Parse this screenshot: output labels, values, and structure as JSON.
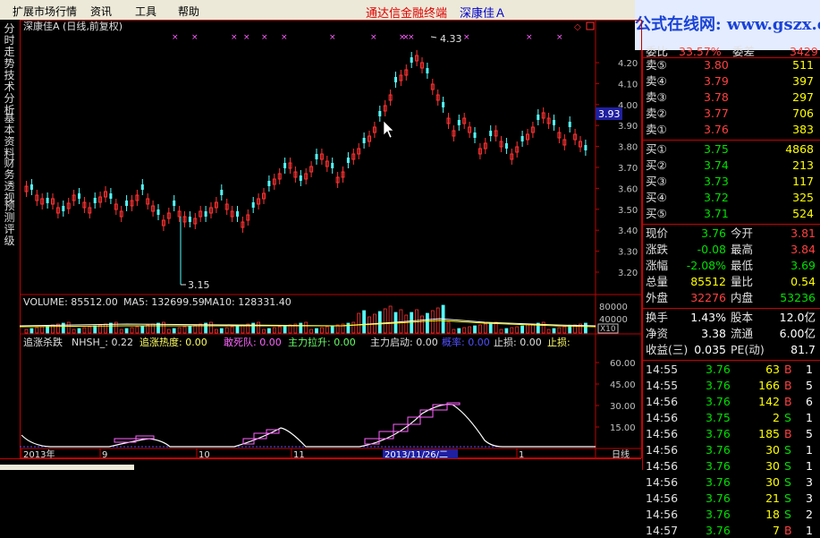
{
  "menu": {
    "items": [
      "扩展市场行情",
      "资讯",
      "工具",
      "帮助"
    ],
    "brand": "通达信金融终端",
    "stock_title": "深康佳Ａ"
  },
  "watermark": "公式在线网: www.gszx.com.cn",
  "left_tabs": [
    "分时走势",
    "技术分析",
    "基本资料",
    "财务透视",
    "预测评级"
  ],
  "chart": {
    "title": "深康佳A (日线,前复权)",
    "high_label": "4.33",
    "low_label": "3.15",
    "current_price_tag": "3.93",
    "price_ticks": [
      "4.20",
      "4.10",
      "4.00",
      "3.90",
      "3.80",
      "3.70",
      "3.60",
      "3.50",
      "3.40",
      "3.30",
      "3.20"
    ],
    "volume_legend": {
      "vol": "VOLUME: 85512.00",
      "ma5": "MA5: 132699.59",
      "ma10": "MA10: 128331.40"
    },
    "volume_ticks": [
      "80000",
      "40000"
    ],
    "volume_unit": "X10",
    "indicator_legend": {
      "name": "追涨杀跌",
      "nhsh": "NHSH_: 0.22",
      "heat": "追涨热度: 0.00",
      "dead": "敢死队: 0.00",
      "main_pull": "主力拉升: 0.00",
      "main_start": "主力启动: 0.00",
      "hidden": "概率: 0.00",
      "stop_loss": "止损: 0.00",
      "stop_profit": "止损:"
    },
    "indicator_ticks": [
      "60.00",
      "45.00",
      "30.00",
      "15.00"
    ],
    "date_labels": [
      "2013年",
      "9",
      "10",
      "11",
      "1"
    ],
    "cursor_date": "2013/11/26/二",
    "period": "日线"
  },
  "quote_panel": {
    "top_partial": {
      "label": "委比",
      "value": "33.57%",
      "label2": "委差",
      "value2": "3429"
    },
    "asks": [
      {
        "label": "卖⑤",
        "price": "3.80",
        "vol": "511"
      },
      {
        "label": "卖④",
        "price": "3.79",
        "vol": "397"
      },
      {
        "label": "卖③",
        "price": "3.78",
        "vol": "297"
      },
      {
        "label": "卖②",
        "price": "3.77",
        "vol": "706"
      },
      {
        "label": "卖①",
        "price": "3.76",
        "vol": "383"
      }
    ],
    "bids": [
      {
        "label": "买①",
        "price": "3.75",
        "vol": "4868"
      },
      {
        "label": "买②",
        "price": "3.74",
        "vol": "213"
      },
      {
        "label": "买③",
        "price": "3.73",
        "vol": "117"
      },
      {
        "label": "买④",
        "price": "3.72",
        "vol": "325"
      },
      {
        "label": "买⑤",
        "price": "3.71",
        "vol": "524"
      }
    ],
    "stats": [
      {
        "l1": "现价",
        "v1": "3.76",
        "l2": "今开",
        "v2": "3.81"
      },
      {
        "l1": "涨跌",
        "v1": "-0.08",
        "l2": "最高",
        "v2": "3.84"
      },
      {
        "l1": "涨幅",
        "v1": "-2.08%",
        "l2": "最低",
        "v2": "3.69"
      },
      {
        "l1": "总量",
        "v1": "85512",
        "l2": "量比",
        "v2": "0.54"
      },
      {
        "l1": "外盘",
        "v1": "32276",
        "l2": "内盘",
        "v2": "53236"
      }
    ],
    "fundamentals": [
      {
        "l1": "换手",
        "v1": "1.43%",
        "l2": "股本",
        "v2": "12.0亿"
      },
      {
        "l1": "净资",
        "v1": "3.38",
        "l2": "流通",
        "v2": "6.00亿"
      },
      {
        "l1": "收益(三)",
        "v1": "0.035",
        "l2": "PE(动)",
        "v2": "81.7"
      }
    ],
    "ticks": [
      {
        "time": "14:55",
        "price": "3.76",
        "vol": "63",
        "side": "B",
        "n": "1"
      },
      {
        "time": "14:55",
        "price": "3.76",
        "vol": "166",
        "side": "B",
        "n": "5"
      },
      {
        "time": "14:56",
        "price": "3.76",
        "vol": "142",
        "side": "B",
        "n": "6"
      },
      {
        "time": "14:56",
        "price": "3.75",
        "vol": "2",
        "side": "S",
        "n": "1"
      },
      {
        "time": "14:56",
        "price": "3.76",
        "vol": "185",
        "side": "B",
        "n": "5"
      },
      {
        "time": "14:56",
        "price": "3.76",
        "vol": "30",
        "side": "S",
        "n": "1"
      },
      {
        "time": "14:56",
        "price": "3.76",
        "vol": "30",
        "side": "S",
        "n": "1"
      },
      {
        "time": "14:56",
        "price": "3.76",
        "vol": "30",
        "side": "S",
        "n": "3"
      },
      {
        "time": "14:56",
        "price": "3.76",
        "vol": "21",
        "side": "S",
        "n": "3"
      },
      {
        "time": "14:56",
        "price": "3.76",
        "vol": "18",
        "side": "S",
        "n": "2"
      },
      {
        "time": "14:57",
        "price": "3.76",
        "vol": "7",
        "side": "B",
        "n": "1"
      }
    ]
  },
  "colors": {
    "up": "#ff3232",
    "down": "#54fcfc",
    "accent_red": "#c00000",
    "bg": "#000000"
  }
}
